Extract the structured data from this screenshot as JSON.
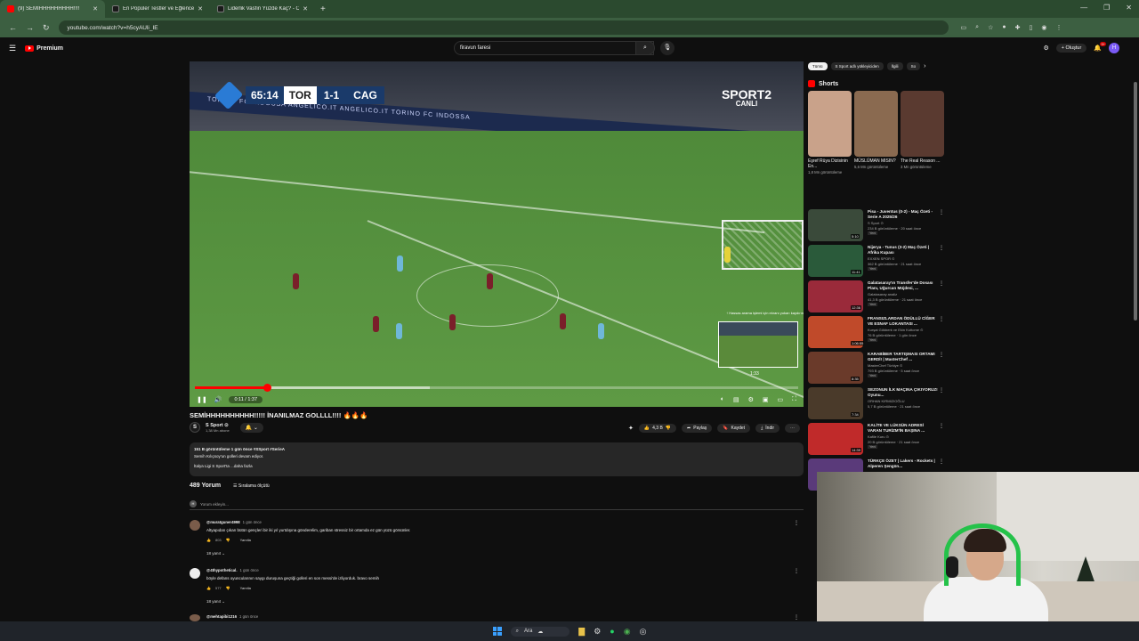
{
  "browser": {
    "tabs": [
      {
        "title": "(9) SEMİHHHHHHHHH!!!!",
        "color": "#ff0000"
      },
      {
        "title": "En Popüler Testler ve Eğlenceli",
        "color": "#1a1a1a"
      },
      {
        "title": "Liderlik Vasfın Yüzde Kaç? - Onl",
        "color": "#1a1a1a"
      }
    ],
    "url": "youtube.com/watch?v=h5cyAUli_IE"
  },
  "youtube": {
    "logo_text": "Premium",
    "search_value": "firavun faresi",
    "create_label": "Oluştur",
    "notif_count": "9+",
    "avatar_letter": "H"
  },
  "video": {
    "scorebug": {
      "time": "65:14",
      "home": "TOR",
      "score": "1-1",
      "away": "CAG"
    },
    "channel_logo": "SPORT",
    "channel_logo_num": "2",
    "channel_logo_sub": "CANLI",
    "adboard": "TORINO FC INDOSSA          ANGELICO.IT     ANGELICO.IT          TORINO FC INDOSSA",
    "preview_hint": "↑ Hassas arama işlemi için ekranı yukarı kaydırın",
    "preview_time": "1:33",
    "time_display": "0:11 / 1:37",
    "progress": 0.12,
    "buffered": 0.39,
    "title": "SEMİHHHHHHHHHH!!!!! İNANILMAZ GOLLLL!!!! 🔥🔥🔥",
    "channel_name": "S Sport ⊙",
    "subscribers": "1,38 Mn abone",
    "likes": "4,3 B",
    "share_label": "Paylaş",
    "save_label": "Kaydet",
    "download_label": "İndir"
  },
  "description": {
    "stats": "151 B görüntüleme  1 gün önce  #SSport #SerieA",
    "line1": "Semih Kılıçsoy'un golleri devam ediyor.",
    "line2": "İtalya Ligi S Sport'ta ...daha fazla"
  },
  "comments": {
    "count": "489 Yorum",
    "sort_label": "Sıralama ölçütü",
    "add_placeholder": "Yorum ekleyin...",
    "items": [
      {
        "user": "@muratguner4998",
        "when": "1 gün önce",
        "text": "Altyapıdan çıkan bütün gençleri bir iki yıl yurtdışına gönderelim, gariban stressiz bir ortamda ez gün yüzü görsünler.",
        "likes": "803",
        "reply": "Yanıtla",
        "replies": "18 yanıt"
      },
      {
        "user": "@4thypothetical.",
        "when": "1 gün önce",
        "text": "böyle defans oyuncularının saygı duruşuna geçtiği golleri en son messi'de izliyorduk. bravo semih",
        "likes": "577",
        "reply": "Yanıtla",
        "replies": "18 yanıt"
      },
      {
        "user": "@mehtapibi1216",
        "when": "1 gün önce",
        "text": "",
        "likes": "",
        "reply": "",
        "replies": ""
      }
    ]
  },
  "sidebar": {
    "chips": [
      "Tümü",
      "S Sport adlı yükleyiciden",
      "İlgili",
      "So"
    ],
    "shorts_heading": "Shorts",
    "shorts": [
      {
        "title": "Eşref Rüya Dizisinin En...",
        "views": "1,8 Mn görüntüleme",
        "color": "#c9a28a"
      },
      {
        "title": "MÜSLÜMAN MISIN?",
        "views": "5,6 Mn görüntüleme",
        "color": "#8a6a50"
      },
      {
        "title": "The Real Reason ...",
        "views": "3 Mn görüntüleme",
        "color": "#5a3a30"
      }
    ],
    "videos": [
      {
        "title": "Pisa - Juventus (0-2) - Maç Özeti - Serie A 2025/26",
        "channel": "S Sport ⊙",
        "meta": "234 B görüntüleme · 20 saat önce",
        "new": "Yeni",
        "duration": "5:10",
        "color": "#3a4a3a"
      },
      {
        "title": "Nijerya - Tunus (3-2) Maç Özeti | Afrika Kupası",
        "channel": "EXXEN SPOR ⊙",
        "meta": "362 B görüntüleme · 21 saat önce",
        "new": "Yeni",
        "duration": "11:41",
        "color": "#2a5a3a"
      },
      {
        "title": "Galatasaray'ın Transfer'de Dosası Planı, Uğurcan Müjdesi, ...",
        "channel": "Galatasaray analiz",
        "meta": "41,3 B görüntüleme · 21 saat önce",
        "new": "Yeni",
        "duration": "12:36",
        "color": "#9a2a3a"
      },
      {
        "title": "FRANSIZLARDAN ÖDÜLLÜ CİĞER VE ESNAF LOKANTASI ...",
        "channel": "Kurşat Gökberk ve Ekin Kottome ⊙",
        "meta": "76 B görüntüleme · 1 gün önce",
        "new": "Yeni",
        "duration": "1:06:55",
        "color": "#c04a2a"
      },
      {
        "title": "KARABİBER TARTIŞMASI ORTAMI GERDİ! | MasterChef ...",
        "channel": "MasterChef Türkiye ⊙",
        "meta": "793 B görüntüleme · 5 saat önce",
        "new": "Yeni",
        "duration": "8:35",
        "color": "#6a3a2a"
      },
      {
        "title": "SEZONUN İLK MAÇINA ÇIKIYORUZ! Oyunu...",
        "channel": "ORHAN KIRMIZIOĞLU",
        "meta": "5,7 B görüntüleme · 21 saat önce",
        "new": "",
        "duration": "7:34",
        "color": "#4a3a2a"
      },
      {
        "title": "KALİTE VE LÜKSÜN ADRESİ VARAN TURİZM'İN BAŞINA ...",
        "channel": "Kafile Kuru ⊙",
        "meta": "20 B görüntüleme · 21 saat önce",
        "new": "Yeni",
        "duration": "14:39",
        "color": "#c02a2a"
      },
      {
        "title": "TÜRKÇE ÖZET | Lakers - Rockets | Alperen Şengün...",
        "channel": "",
        "meta": "",
        "new": "",
        "duration": "",
        "color": "#5a3a7a"
      }
    ]
  },
  "taskbar": {
    "search_label": "Ara"
  }
}
